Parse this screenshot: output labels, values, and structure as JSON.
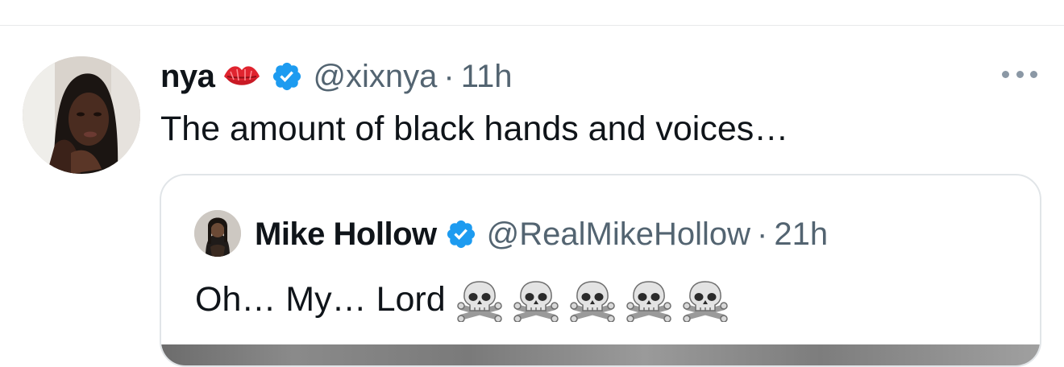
{
  "tweet": {
    "display_name": "nya",
    "name_emoji": "kiss-mark-icon",
    "handle": "@xixnya",
    "separator": "·",
    "time": "11h",
    "text": "The amount of black hands and voices…",
    "verified_color": "#1d9bf0"
  },
  "quoted_tweet": {
    "display_name": "Mike Hollow",
    "handle": "@RealMikeHollow",
    "separator": "·",
    "time": "21h",
    "text": "Oh… My… Lord",
    "emoji": [
      "skull-crossbones-icon",
      "skull-crossbones-icon",
      "skull-crossbones-icon",
      "skull-crossbones-icon",
      "skull-crossbones-icon"
    ]
  },
  "colors": {
    "text_primary": "#0f1419",
    "text_secondary": "#536471",
    "border": "#e1e5e8",
    "verified": "#1d9bf0"
  }
}
